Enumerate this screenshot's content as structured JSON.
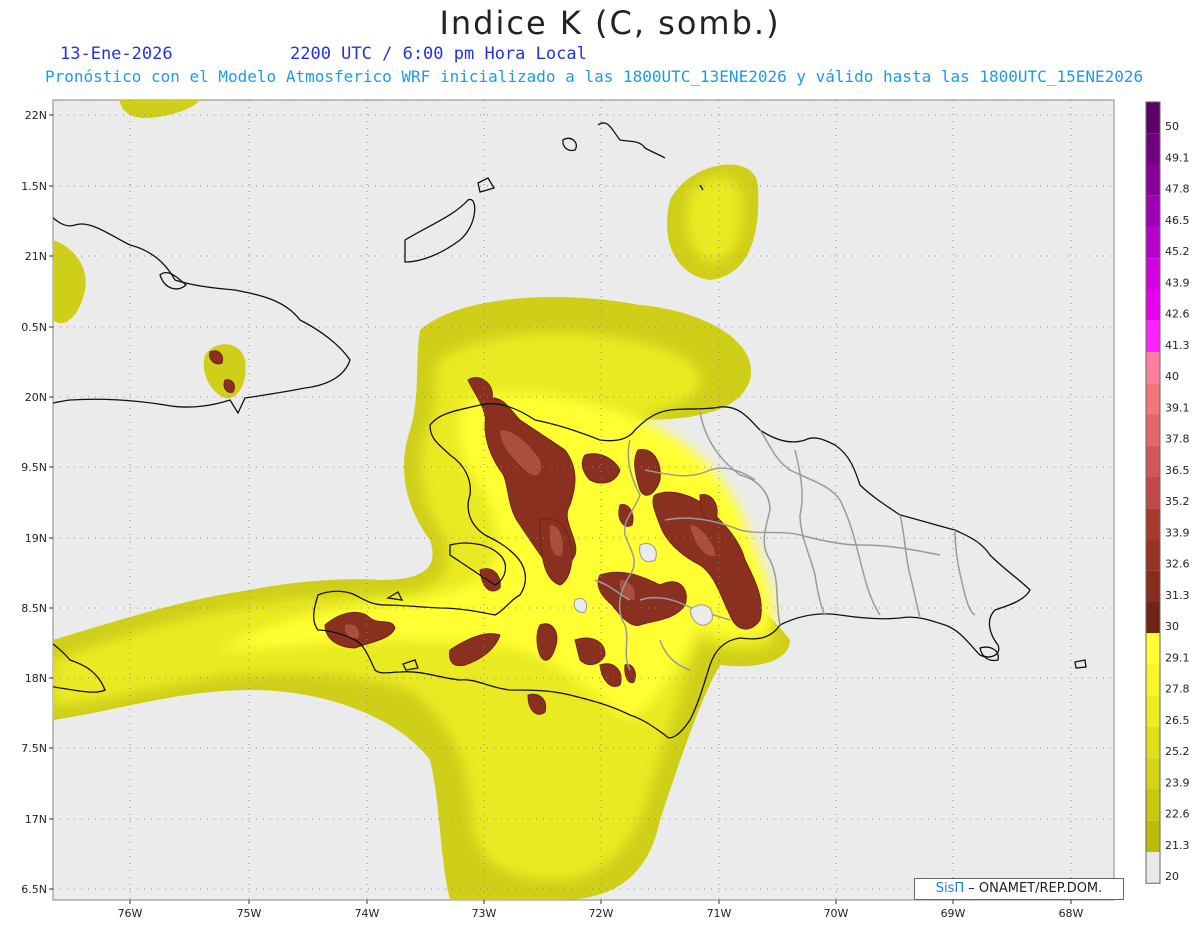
{
  "header": {
    "title": "Indice K (C, somb.)",
    "date": "13-Ene-2026",
    "time": "2200 UTC / 6:00 pm Hora Local",
    "subtitle": "Pronóstico con el Modelo Atmosferico WRF inicializado a las 1800UTC_13ENE2026 y válido hasta las  1800UTC_15ENE2026"
  },
  "map": {
    "lat_labels": [
      "22N",
      "1.5N",
      "21N",
      "0.5N",
      "20N",
      "9.5N",
      "19N",
      "8.5N",
      "18N",
      "7.5N",
      "17N",
      "6.5N"
    ],
    "lon_labels": [
      "76W",
      "75W",
      "74W",
      "73W",
      "72W",
      "71W",
      "70W",
      "69W",
      "68W"
    ]
  },
  "colorbar": {
    "labels": [
      "50",
      "49.1",
      "47.8",
      "46.5",
      "45.2",
      "43.9",
      "42.6",
      "41.3",
      "40",
      "39.1",
      "37.8",
      "36.5",
      "35.2",
      "33.9",
      "32.6",
      "31.3",
      "30",
      "29.1",
      "27.8",
      "26.5",
      "25.2",
      "23.9",
      "22.6",
      "21.3",
      "20"
    ],
    "colors": [
      "#5a0066",
      "#700080",
      "#880099",
      "#a000b3",
      "#b800cc",
      "#d000e0",
      "#e800ee",
      "#ff22ff",
      "#ff80a0",
      "#f07878",
      "#e06868",
      "#d05858",
      "#c04848",
      "#a83a2c",
      "#983224",
      "#882c1c",
      "#702414",
      "#ffff33",
      "#f5f52a",
      "#ecec22",
      "#e0e01a",
      "#d4d414",
      "#c8c80e",
      "#bcbc08",
      "#e8e8e8"
    ]
  },
  "credit": {
    "brand": "SisΠ",
    "text": "– ONAMET/REP.DOM."
  }
}
